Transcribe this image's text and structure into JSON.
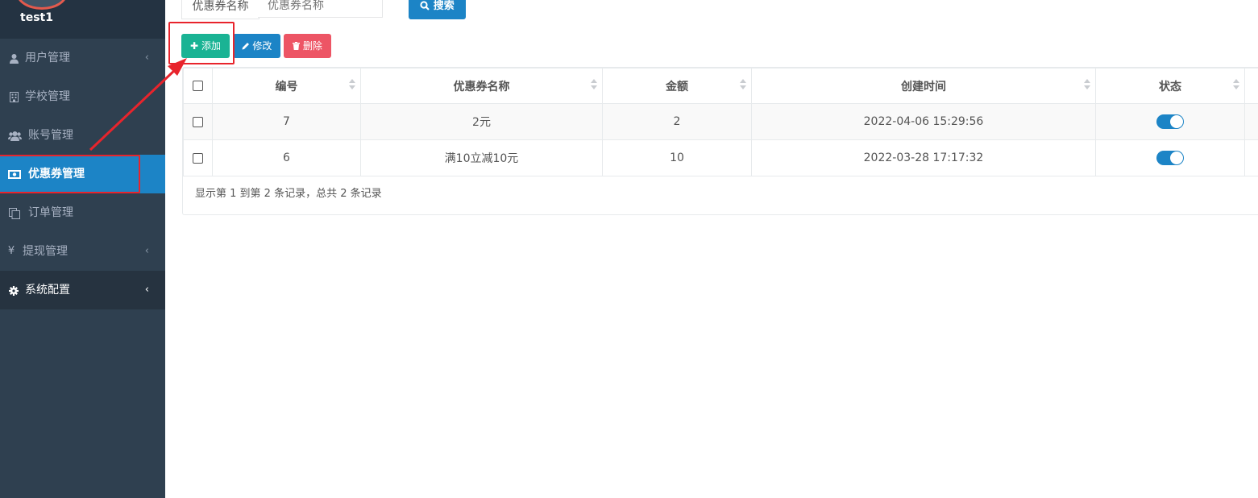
{
  "sidebar": {
    "username": "test1",
    "items": [
      {
        "label": "用户管理",
        "icon": "user-icon",
        "has_arrow": true
      },
      {
        "label": "学校管理",
        "icon": "building-icon",
        "has_arrow": false
      },
      {
        "label": "账号管理",
        "icon": "users-icon",
        "has_arrow": false
      },
      {
        "label": "优惠券管理",
        "icon": "money-icon",
        "has_arrow": false,
        "active": true
      },
      {
        "label": "订单管理",
        "icon": "copy-icon",
        "has_arrow": false
      },
      {
        "label": "提现管理",
        "icon": "yen-icon",
        "has_arrow": true
      },
      {
        "label": "系统配置",
        "icon": "gear-icon",
        "has_arrow": true
      }
    ],
    "arrow_glyph": "‹"
  },
  "search": {
    "label": "优惠券名称",
    "placeholder": "优惠券名称",
    "button_label": "搜索"
  },
  "toolbar": {
    "add_label": "添加",
    "edit_label": "修改",
    "delete_label": "删除"
  },
  "table": {
    "columns": [
      "编号",
      "优惠券名称",
      "金额",
      "创建时间",
      "状态"
    ],
    "rows": [
      {
        "id": "7",
        "name": "2元",
        "amount": "2",
        "created": "2022-04-06 15:29:56",
        "status_on": true
      },
      {
        "id": "6",
        "name": "满10立减10元",
        "amount": "10",
        "created": "2022-03-28 17:17:32",
        "status_on": true
      }
    ],
    "footer": "显示第 1 到第 2 条记录，总共 2 条记录"
  },
  "colors": {
    "sidebar_bg": "#2f4050",
    "active": "#1c84c6",
    "add_green": "#1ab394",
    "delete_red": "#ed5565",
    "annotation_red": "#e8242c"
  }
}
